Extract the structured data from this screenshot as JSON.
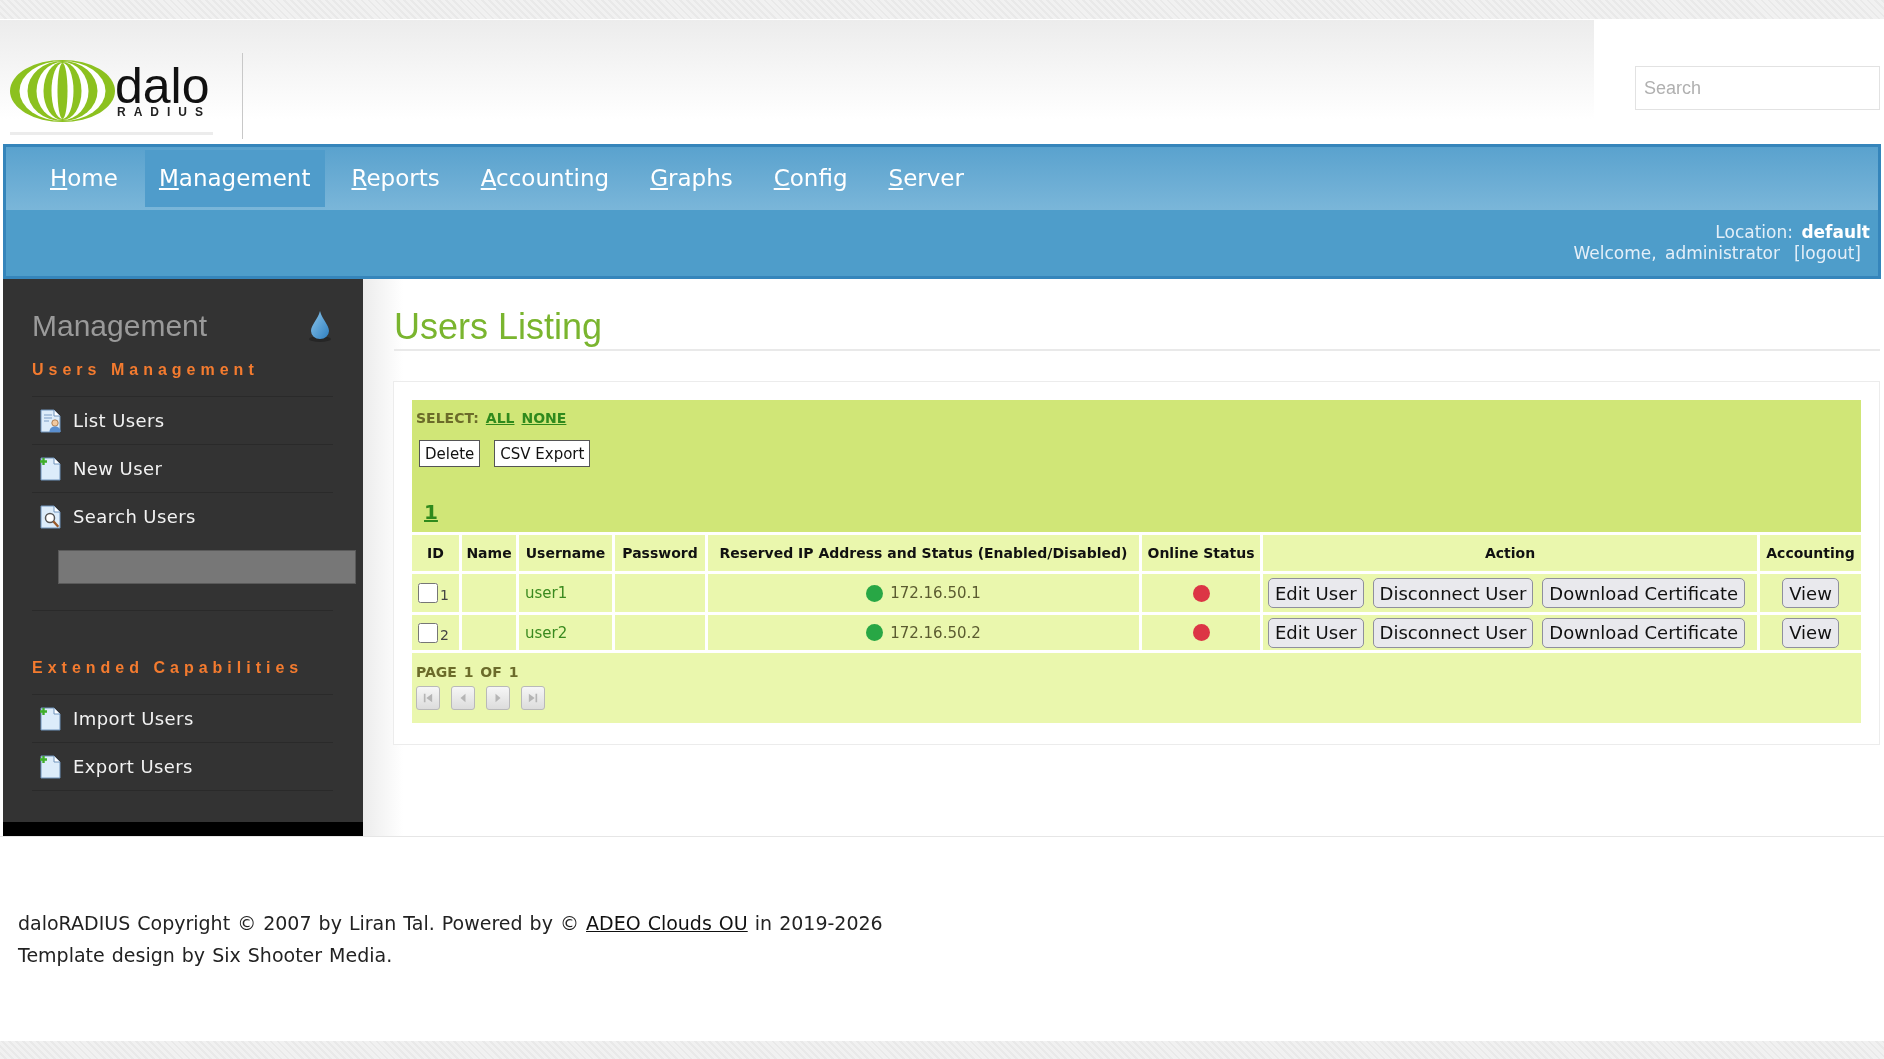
{
  "header": {
    "logo": {
      "name": "dalo",
      "tagline": "RADIUS"
    },
    "search": {
      "placeholder": "Search"
    }
  },
  "nav": {
    "items": [
      {
        "label": "Home",
        "selected": false
      },
      {
        "label": "Management",
        "selected": true
      },
      {
        "label": "Reports",
        "selected": false
      },
      {
        "label": "Accounting",
        "selected": false
      },
      {
        "label": "Graphs",
        "selected": false
      },
      {
        "label": "Config",
        "selected": false
      },
      {
        "label": "Server",
        "selected": false
      }
    ],
    "location": "Location: **default**",
    "welcome": "Welcome, administrator",
    "logout": "[logout]"
  },
  "sidebar": {
    "title": "Management",
    "sections": [
      {
        "heading": "Users Management",
        "items": [
          {
            "kind": "list",
            "label": "List Users"
          },
          {
            "kind": "add",
            "label": "New User"
          },
          {
            "kind": "search",
            "label": "Search Users",
            "field": true
          }
        ]
      },
      {
        "heading": "Extended Capabilities",
        "items": [
          {
            "kind": "add",
            "label": "Import Users"
          },
          {
            "kind": "add",
            "label": "Export Users"
          }
        ]
      }
    ]
  },
  "content": {
    "title": "Users Listing",
    "select_label": "SELECT:",
    "select_links": [
      "ALL",
      "NONE"
    ],
    "buttons": [
      "Delete",
      "CSV Export"
    ],
    "page_links": [
      "1"
    ]
  },
  "table": {
    "columns": [
      "ID",
      "Name",
      "Username",
      "Password",
      "Reserved IP Address and Status (Enabled/Disabled)",
      "Online Status",
      "Action",
      "Accounting"
    ],
    "rows": [
      {
        "checked": false,
        "id": "1",
        "username": "user1",
        "ip": "172.16.50.1",
        "ip_enabled": true,
        "online": false,
        "actions": [
          "Edit User",
          "Disconnect User",
          "Download Certificate"
        ],
        "accounting": "View"
      },
      {
        "checked": false,
        "id": "2",
        "username": "user2",
        "ip": "172.16.50.2",
        "ip_enabled": true,
        "online": false,
        "actions": [
          "Edit User",
          "Disconnect User",
          "Download Certificate"
        ],
        "accounting": "View"
      }
    ]
  },
  "pager": {
    "label": "PAGE 1 OF 1",
    "buttons": [
      {
        "kind": "first",
        "disabled": true
      },
      {
        "kind": "previous",
        "disabled": true
      },
      {
        "kind": "next",
        "disabled": true
      },
      {
        "kind": "last",
        "disabled": true
      }
    ]
  },
  "footer": {
    "copyright": {
      "before": "daloRADIUS Copyright © 2007 by Liran Tal. Powered by ©",
      "link": "ADEO Clouds OU",
      "after": "in 2019-2026"
    },
    "credits": "Template design by Six Shooter Media."
  }
}
